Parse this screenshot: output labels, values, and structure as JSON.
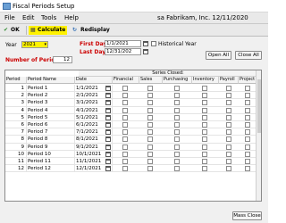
{
  "window": {
    "title": "Fiscal Periods Setup"
  },
  "menu": {
    "items": [
      "File",
      "Edit",
      "Tools",
      "Help"
    ],
    "company": "sa  Fabrikam, Inc. 12/11/2020"
  },
  "toolbar": {
    "ok": "OK",
    "calculate": "Calculate",
    "redisplay": "Redisplay"
  },
  "form": {
    "year_label": "Year",
    "year_value": "2021",
    "first_day_label": "First Day",
    "first_day_value": "1/1/2021",
    "last_day_label": "Last Day",
    "last_day_value": "12/31/202",
    "historical_label": "Historical Year",
    "num_periods_label": "Number of Periods",
    "num_periods_value": "12",
    "open_all": "Open All",
    "close_all": "Close All"
  },
  "grid": {
    "series_closed": "Series Closed:",
    "columns": [
      "Period",
      "Period Name",
      "Date",
      "Financial",
      "Sales",
      "Purchasing",
      "Inventory",
      "Payroll",
      "Project"
    ],
    "rows": [
      {
        "period": "1",
        "name": "Period 1",
        "date": "1/1/2021"
      },
      {
        "period": "2",
        "name": "Period 2",
        "date": "2/1/2021"
      },
      {
        "period": "3",
        "name": "Period 3",
        "date": "3/1/2021"
      },
      {
        "period": "4",
        "name": "Period 4",
        "date": "4/1/2021"
      },
      {
        "period": "5",
        "name": "Period 5",
        "date": "5/1/2021"
      },
      {
        "period": "6",
        "name": "Period 6",
        "date": "6/1/2021"
      },
      {
        "period": "7",
        "name": "Period 7",
        "date": "7/1/2021"
      },
      {
        "period": "8",
        "name": "Period 8",
        "date": "8/1/2021"
      },
      {
        "period": "9",
        "name": "Period 9",
        "date": "9/1/2021"
      },
      {
        "period": "10",
        "name": "Period 10",
        "date": "10/1/2021"
      },
      {
        "period": "11",
        "name": "Period 11",
        "date": "11/1/2021"
      },
      {
        "period": "12",
        "name": "Period 12",
        "date": "12/1/2021"
      }
    ]
  },
  "footer": {
    "mass_close": "Mass Close"
  }
}
